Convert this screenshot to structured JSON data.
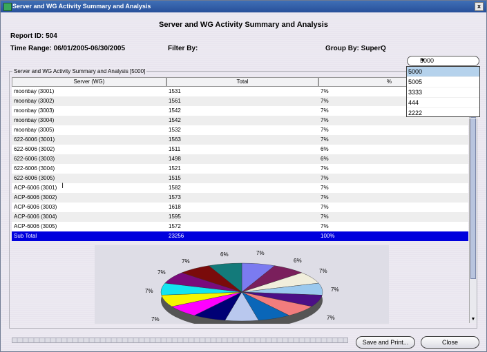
{
  "window": {
    "title": "Server and WG Activity Summary and Analysis",
    "close_label": "x"
  },
  "report": {
    "heading": "Server and WG Activity Summary and Analysis",
    "report_id": "Report ID: 504",
    "time_range": "Time Range: 06/01/2005-06/30/2005",
    "filter_by": "Filter By:",
    "group_by": "Group By: SuperQ"
  },
  "selector": {
    "selected": "5000",
    "options": [
      "5000",
      "5005",
      "3333",
      "444",
      "2222"
    ]
  },
  "group_title": "Server and WG Activity Summary and Analysis [5000]",
  "table": {
    "headers": [
      "Server (WG)",
      "Total",
      "%"
    ],
    "rows": [
      [
        "moonbay (3001)",
        "1531",
        "7%"
      ],
      [
        "moonbay (3002)",
        "1561",
        "7%"
      ],
      [
        "moonbay (3003)",
        "1542",
        "7%"
      ],
      [
        "moonbay (3004)",
        "1542",
        "7%"
      ],
      [
        "moonbay (3005)",
        "1532",
        "7%"
      ],
      [
        "622-6006 (3001)",
        "1563",
        "7%"
      ],
      [
        "622-6006 (3002)",
        "1511",
        "6%"
      ],
      [
        "622-6006 (3003)",
        "1498",
        "6%"
      ],
      [
        "622-6006 (3004)",
        "1521",
        "7%"
      ],
      [
        "622-6006 (3005)",
        "1515",
        "7%"
      ],
      [
        "ACP-6006 (3001)",
        "1582",
        "7%"
      ],
      [
        "ACP-6006 (3002)",
        "1573",
        "7%"
      ],
      [
        "ACP-6006 (3003)",
        "1618",
        "7%"
      ],
      [
        "ACP-6006 (3004)",
        "1595",
        "7%"
      ],
      [
        "ACP-6006 (3005)",
        "1572",
        "7%"
      ]
    ],
    "subtotal": [
      "Sub Total",
      "23256",
      "100%"
    ]
  },
  "pie": {
    "labels": [
      "6%",
      "7%",
      "6%",
      "7%",
      "7%",
      "7%",
      "7%",
      "7%",
      "7%"
    ],
    "colors": [
      "#7b7bf0",
      "#7a1f5c",
      "#f1eedc",
      "#9bc9ee",
      "#4b0f86",
      "#f27d7d",
      "#0a66b8",
      "#b9c8ee",
      "#000075",
      "#ff00ff",
      "#f5f500",
      "#14e4f0",
      "#7a0b7c",
      "#7a0b0b",
      "#137a7a"
    ]
  },
  "buttons": {
    "save_print": "Save and Print...",
    "close": "Close"
  }
}
